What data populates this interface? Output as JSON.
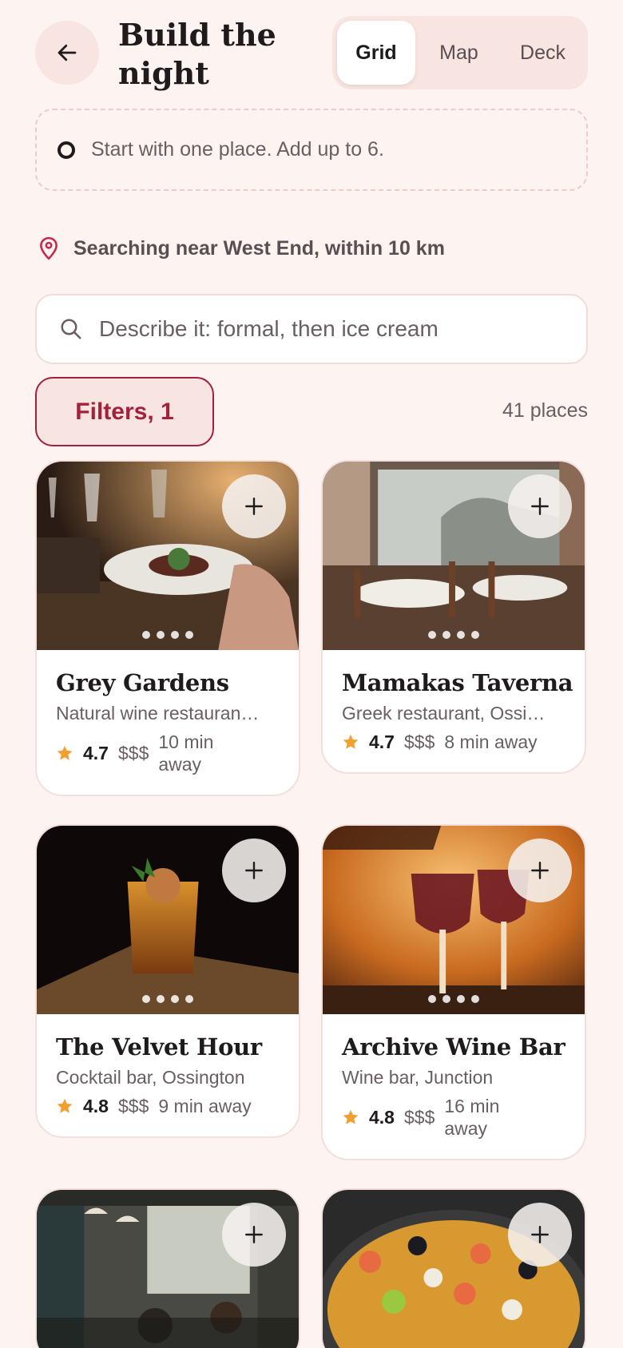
{
  "header": {
    "title": "Build the night",
    "tabs": [
      {
        "label": "Grid",
        "active": true
      },
      {
        "label": "Map",
        "active": false
      },
      {
        "label": "Deck",
        "active": false
      }
    ]
  },
  "start_prompt": "Start with one place. Add up to 6.",
  "location": "Searching near West End, within 10 km",
  "search": {
    "placeholder": "Describe it: formal, then ice cream"
  },
  "filters_label": "Filters, 1",
  "result_count": "41 places",
  "colors": {
    "accent": "#a3213f",
    "background": "#fdf3f1",
    "star": "#f0a030"
  },
  "places": [
    {
      "name": "Grey Gardens",
      "category": "Natural wine restauran…",
      "rating": "4.7",
      "price": "$$$",
      "distance": "10 min away"
    },
    {
      "name": "Mamakas Taverna",
      "category": "Greek restaurant, Ossi…",
      "rating": "4.7",
      "price": "$$$",
      "distance": "8 min away"
    },
    {
      "name": "The Velvet Hour",
      "category": "Cocktail bar, Ossington",
      "rating": "4.8",
      "price": "$$$",
      "distance": "9 min away"
    },
    {
      "name": "Archive Wine Bar",
      "category": "Wine bar, Junction",
      "rating": "4.8",
      "price": "$$$",
      "distance": "16 min away"
    }
  ]
}
